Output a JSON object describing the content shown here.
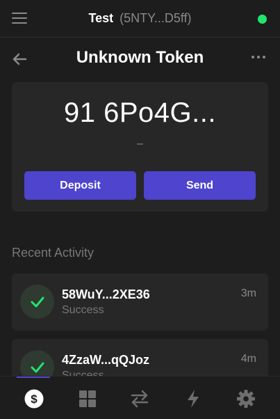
{
  "header": {
    "wallet_name": "Test",
    "wallet_address": "(5NTY...D5ff)",
    "status_color": "#21e56f",
    "menu_icon": "hamburger-menu-icon"
  },
  "page": {
    "title": "Unknown Token",
    "back_icon": "arrow-left-icon",
    "more_icon": "more-horizontal-icon"
  },
  "balance": {
    "amount": "91 6Po4G...",
    "usd_value": "–"
  },
  "actions": {
    "deposit_label": "Deposit",
    "send_label": "Send",
    "accent_color": "#4e44ce"
  },
  "recent_activity": {
    "title": "Recent Activity",
    "items": [
      {
        "signature": "58WuY...2XE36",
        "status": "Success",
        "time": "3m"
      },
      {
        "signature": "4ZzaW...qQJoz",
        "status": "Success",
        "time": "4m"
      }
    ]
  },
  "bottom_nav": {
    "tabs": [
      {
        "icon": "dollar-icon",
        "active": true
      },
      {
        "icon": "grid-icon",
        "active": false
      },
      {
        "icon": "swap-arrows-icon",
        "active": false
      },
      {
        "icon": "lightning-icon",
        "active": false
      },
      {
        "icon": "settings-gear-icon",
        "active": false
      }
    ]
  }
}
